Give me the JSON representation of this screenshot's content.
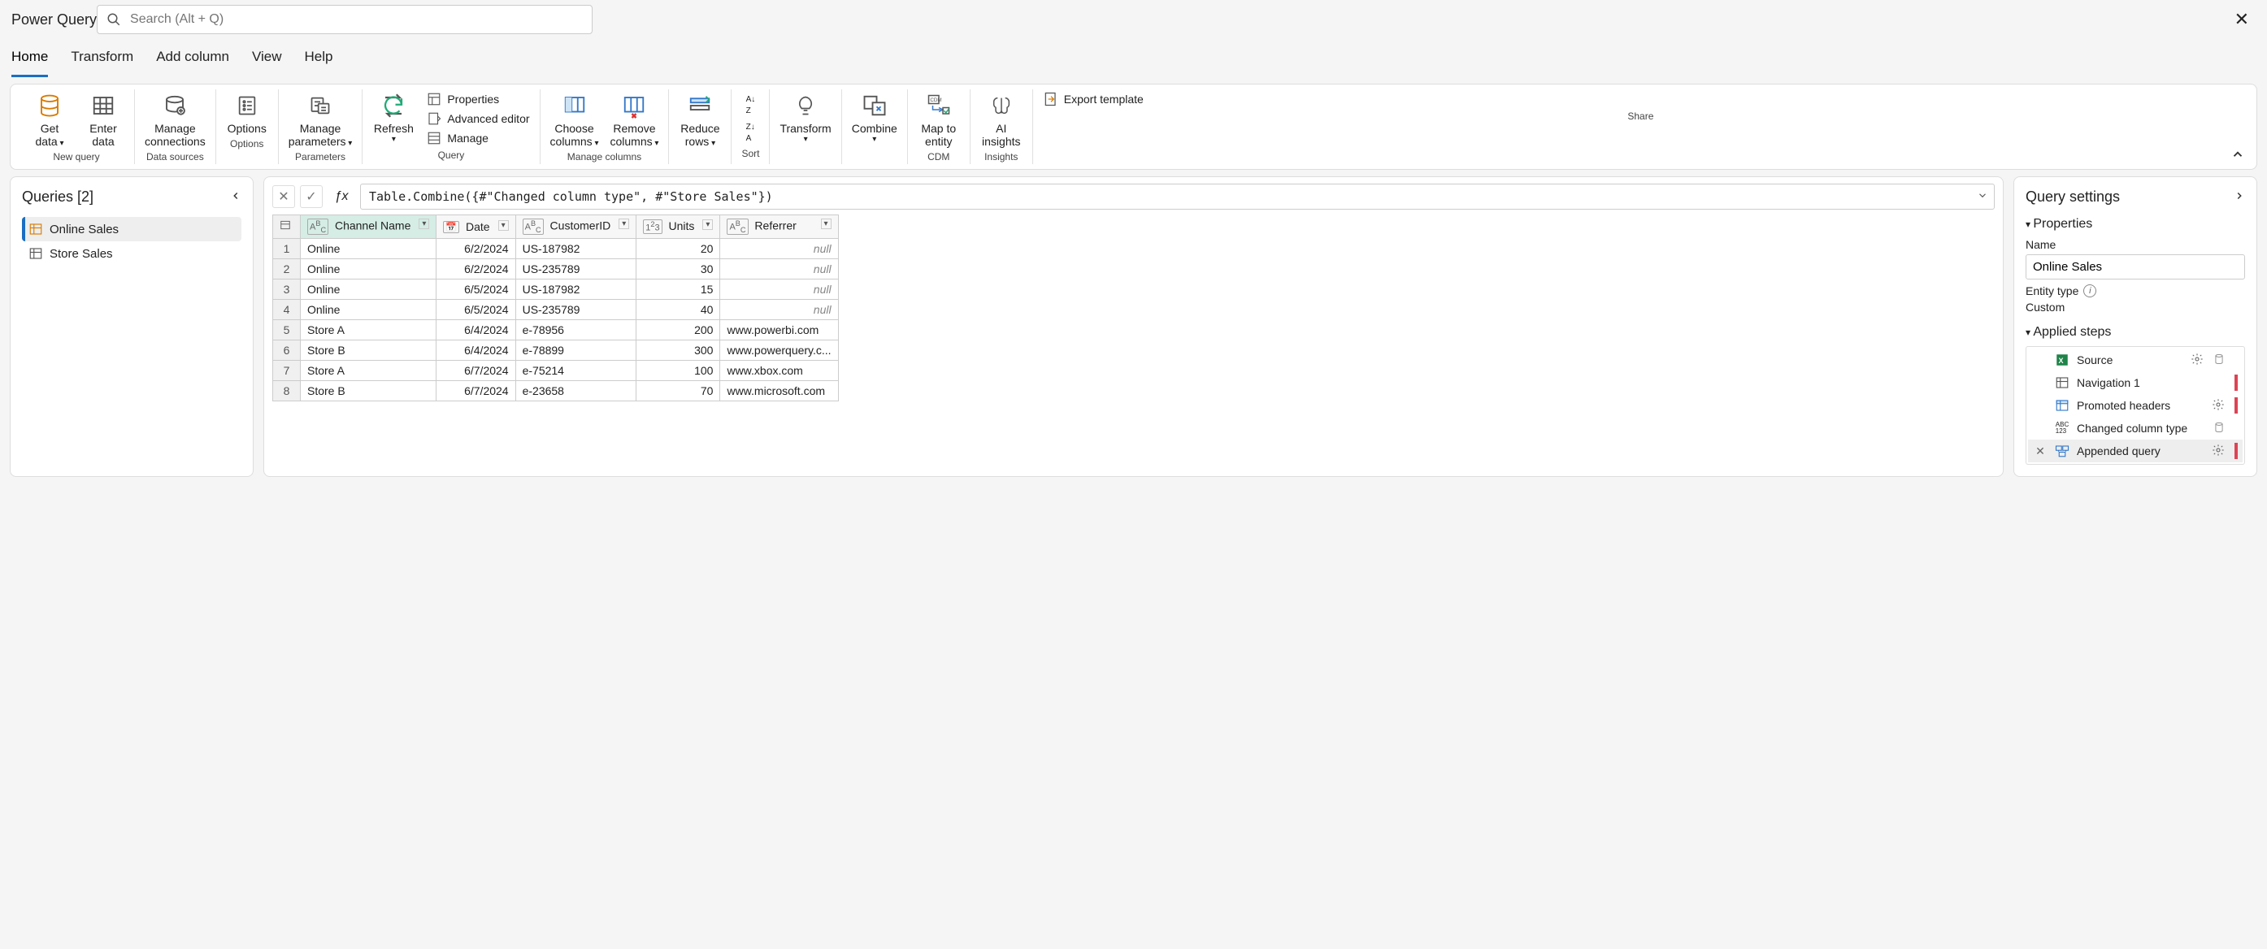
{
  "app_title": "Power Query",
  "search_placeholder": "Search (Alt + Q)",
  "tabs": [
    "Home",
    "Transform",
    "Add column",
    "View",
    "Help"
  ],
  "active_tab": 0,
  "ribbon": {
    "group_labels": [
      "New query",
      "Data sources",
      "Options",
      "Parameters",
      "Query",
      "Manage columns",
      "",
      "Sort",
      "",
      "",
      "CDM",
      "Insights",
      "Share"
    ],
    "get_data": "Get data",
    "enter_data": "Enter data",
    "manage_connections": "Manage connections",
    "options": "Options",
    "manage_parameters": "Manage parameters",
    "refresh": "Refresh",
    "properties": "Properties",
    "advanced_editor": "Advanced editor",
    "manage": "Manage",
    "choose_columns": "Choose columns",
    "remove_columns": "Remove columns",
    "reduce_rows": "Reduce rows",
    "transform": "Transform",
    "combine": "Combine",
    "map_to_entity": "Map to entity",
    "ai_insights": "AI insights",
    "export_template": "Export template"
  },
  "queries": {
    "title": "Queries [2]",
    "items": [
      {
        "label": "Online Sales",
        "selected": true
      },
      {
        "label": "Store Sales",
        "selected": false
      }
    ]
  },
  "formula": "Table.Combine({#\"Changed column type\", #\"Store Sales\"})",
  "columns": [
    {
      "type": "ABC",
      "label": "Channel Name",
      "selected": true
    },
    {
      "type": "date",
      "label": "Date"
    },
    {
      "type": "ABC",
      "label": "CustomerID"
    },
    {
      "type": "123",
      "label": "Units"
    },
    {
      "type": "ABC",
      "label": "Referrer"
    }
  ],
  "rows": [
    [
      "Online",
      "6/2/2024",
      "US-187982",
      "20",
      "null"
    ],
    [
      "Online",
      "6/2/2024",
      "US-235789",
      "30",
      "null"
    ],
    [
      "Online",
      "6/5/2024",
      "US-187982",
      "15",
      "null"
    ],
    [
      "Online",
      "6/5/2024",
      "US-235789",
      "40",
      "null"
    ],
    [
      "Store A",
      "6/4/2024",
      "e-78956",
      "200",
      "www.powerbi.com"
    ],
    [
      "Store B",
      "6/4/2024",
      "e-78899",
      "300",
      "www.powerquery.c..."
    ],
    [
      "Store A",
      "6/7/2024",
      "e-75214",
      "100",
      "www.xbox.com"
    ],
    [
      "Store B",
      "6/7/2024",
      "e-23658",
      "70",
      "www.microsoft.com"
    ]
  ],
  "settings": {
    "title": "Query settings",
    "properties_label": "Properties",
    "name_label": "Name",
    "name_value": "Online Sales",
    "entity_label": "Entity type",
    "entity_value": "Custom",
    "applied_steps_label": "Applied steps",
    "steps": [
      {
        "label": "Source",
        "icon": "xls",
        "gear": true,
        "db": true
      },
      {
        "label": "Navigation 1",
        "icon": "nav",
        "marked": true
      },
      {
        "label": "Promoted headers",
        "icon": "prom",
        "gear": true,
        "marked": true
      },
      {
        "label": "Changed column type",
        "icon": "abc123",
        "db": true
      },
      {
        "label": "Appended query",
        "icon": "append",
        "gear": true,
        "selected": true,
        "marked": true,
        "deletable": true
      }
    ]
  }
}
